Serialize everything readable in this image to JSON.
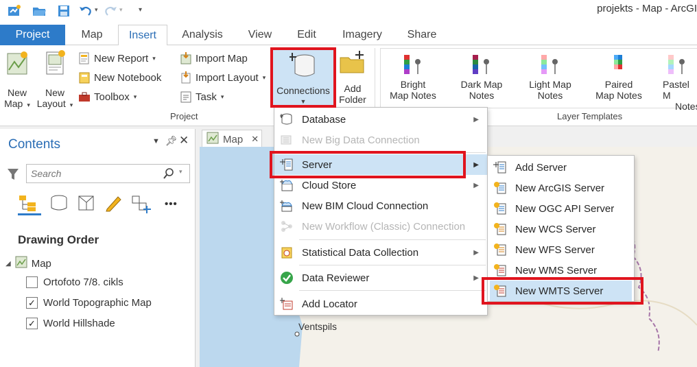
{
  "window": {
    "title": "projekts - Map - ArcGI"
  },
  "tabs": [
    {
      "label": "Project"
    },
    {
      "label": "Map"
    },
    {
      "label": "Insert"
    },
    {
      "label": "Analysis"
    },
    {
      "label": "View"
    },
    {
      "label": "Edit"
    },
    {
      "label": "Imagery"
    },
    {
      "label": "Share"
    }
  ],
  "ribbon": {
    "new_map": {
      "line1": "New",
      "line2": "Map"
    },
    "new_layout": {
      "line1": "New",
      "line2": "Layout"
    },
    "new_report": "New Report",
    "new_notebook": "New Notebook",
    "toolbox": "Toolbox",
    "import_map": "Import Map",
    "import_layout": "Import Layout",
    "task": "Task",
    "connections": "Connections",
    "add_folder": {
      "line1": "Add",
      "line2": "Folder"
    },
    "project_group": "Project",
    "layer_templates_group": "Layer Templates",
    "templates": [
      {
        "line1": "Bright",
        "line2": "Map Notes"
      },
      {
        "line1": "Dark Map",
        "line2": "Notes"
      },
      {
        "line1": "Light Map",
        "line2": "Notes"
      },
      {
        "line1": "Paired",
        "line2": "Map Notes"
      },
      {
        "line1": "Pastel M",
        "line2": "Notes"
      }
    ]
  },
  "contents_pane": {
    "title": "Contents",
    "search_placeholder": "Search",
    "drawing_order": "Drawing Order",
    "map_label": "Map",
    "layers": [
      {
        "name": "Ortofoto 7/8. cikls",
        "checked": false
      },
      {
        "name": "World Topographic Map",
        "checked": true
      },
      {
        "name": "World Hillshade",
        "checked": true
      }
    ]
  },
  "map_view": {
    "tab_label": "Map",
    "place_label": "Ventspils"
  },
  "connections_menu": {
    "items": [
      {
        "label": "Database",
        "submenu": true,
        "enabled": true
      },
      {
        "label": "New Big Data Connection",
        "submenu": false,
        "enabled": false
      },
      {
        "label": "Server",
        "submenu": true,
        "enabled": true
      },
      {
        "label": "Cloud Store",
        "submenu": true,
        "enabled": true
      },
      {
        "label": "New BIM Cloud Connection",
        "submenu": false,
        "enabled": true
      },
      {
        "label": "New Workflow (Classic) Connection",
        "submenu": false,
        "enabled": false
      },
      {
        "label": "Statistical Data Collection",
        "submenu": true,
        "enabled": true
      },
      {
        "label": "Data Reviewer",
        "submenu": true,
        "enabled": true
      },
      {
        "label": "Add Locator",
        "submenu": false,
        "enabled": true
      }
    ]
  },
  "server_submenu": {
    "items": [
      {
        "label": "Add Server"
      },
      {
        "label": "New ArcGIS Server"
      },
      {
        "label": "New OGC API Server"
      },
      {
        "label": "New WCS Server"
      },
      {
        "label": "New WFS Server"
      },
      {
        "label": "New WMS Server"
      },
      {
        "label": "New WMTS Server"
      }
    ]
  },
  "colors": {
    "accent": "#2d7bc9",
    "highlight": "#cde3f5",
    "annotation_red": "#e0141e"
  },
  "icons": {
    "more_tools": "•••"
  }
}
